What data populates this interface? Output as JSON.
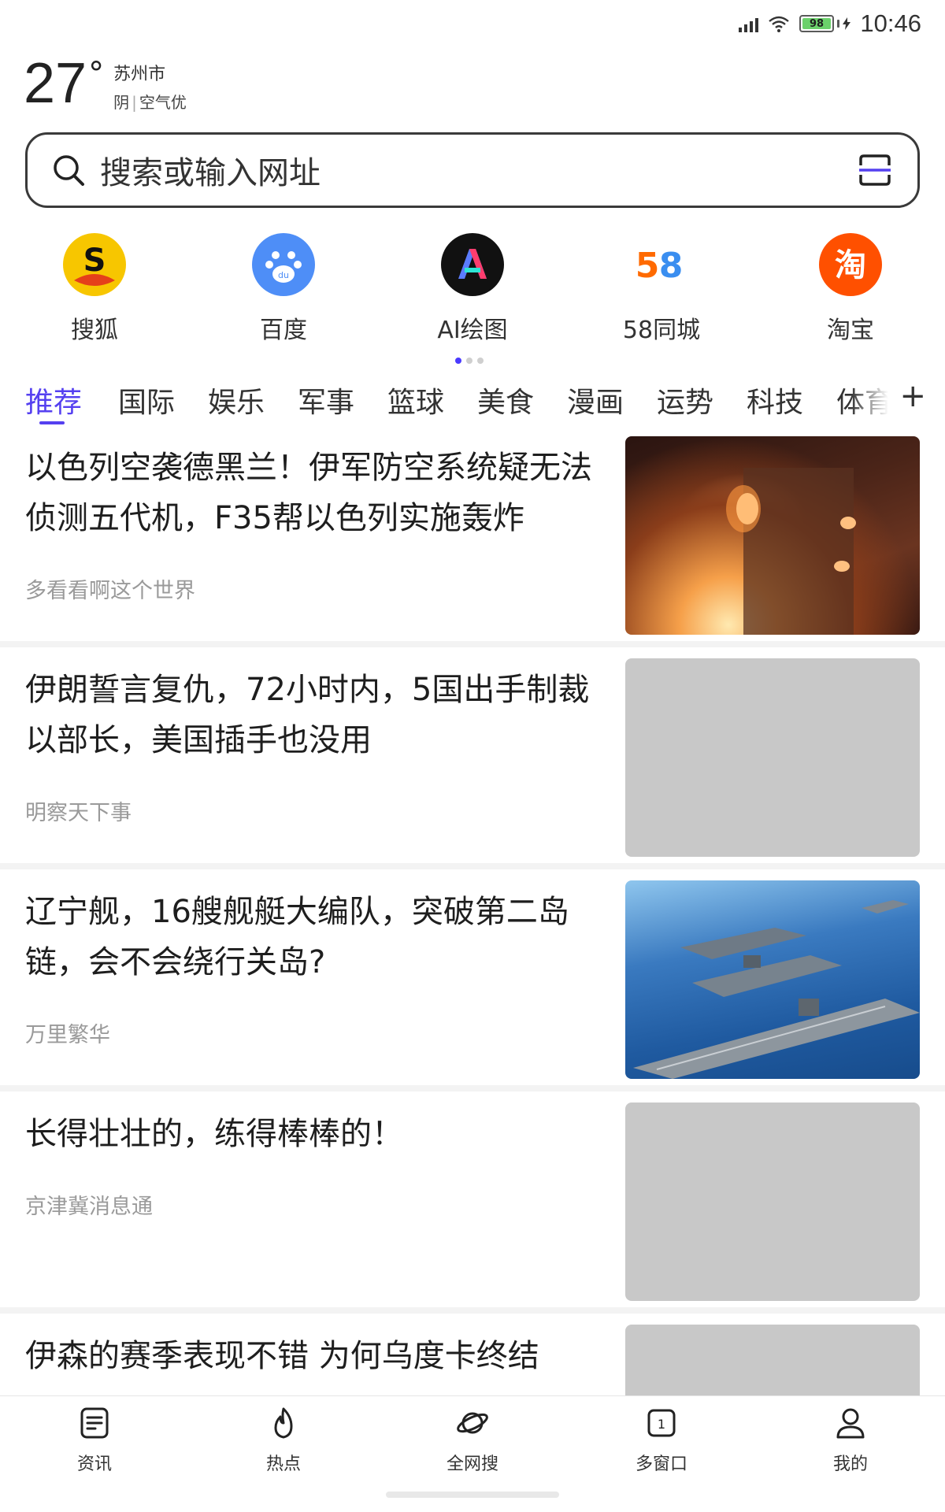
{
  "status_bar": {
    "battery": "98",
    "time": "10:46"
  },
  "weather": {
    "temperature": "27",
    "degree": "°",
    "city": "苏州市",
    "condition": "阴",
    "air": "空气优"
  },
  "search": {
    "placeholder": "搜索或输入网址"
  },
  "quick_links": [
    {
      "label": "搜狐",
      "icon": "sohu-icon",
      "color": "#f7c600"
    },
    {
      "label": "百度",
      "icon": "baidu-icon",
      "color": "#4e8ef7"
    },
    {
      "label": "AI绘图",
      "icon": "ai-draw-icon",
      "color": "#111111"
    },
    {
      "label": "58同城",
      "icon": "58-icon",
      "color": "#ff6a00"
    },
    {
      "label": "淘宝",
      "icon": "taobao-icon",
      "color": "#ff5000"
    }
  ],
  "tabs": [
    "推荐",
    "国际",
    "娱乐",
    "军事",
    "篮球",
    "美食",
    "漫画",
    "运势",
    "科技",
    "体育"
  ],
  "tab_add": "+",
  "feed": [
    {
      "title": "以色列空袭德黑兰！伊军防空系统疑无法侦测五代机，F35帮以色列实施轰炸",
      "source": "多看看啊这个世界",
      "image": "fire-photo"
    },
    {
      "title": "伊朗誓言复仇，72小时内，5国出手制裁以部长，美国插手也没用",
      "source": "明察天下事",
      "image": "placeholder"
    },
    {
      "title": "辽宁舰，16艘舰艇大编队，突破第二岛链，会不会绕行关岛?",
      "source": "万里繁华",
      "image": "carrier-photo"
    },
    {
      "title": "长得壮壮的，练得棒棒的！",
      "source": "京津冀消息通",
      "image": "placeholder"
    },
    {
      "title": "伊森的赛季表现不错 为何乌度卡终结",
      "source": "",
      "image": "placeholder"
    }
  ],
  "bottom_nav": [
    {
      "label": "资讯",
      "icon": "news-icon"
    },
    {
      "label": "热点",
      "icon": "fire-icon"
    },
    {
      "label": "全网搜",
      "icon": "planet-icon"
    },
    {
      "label": "多窗口",
      "icon": "windows-icon"
    },
    {
      "label": "我的",
      "icon": "user-icon"
    }
  ],
  "colors": {
    "accent": "#5540f0",
    "source_text": "#9a9a9a",
    "placeholder_image": "#c8c8c8"
  }
}
